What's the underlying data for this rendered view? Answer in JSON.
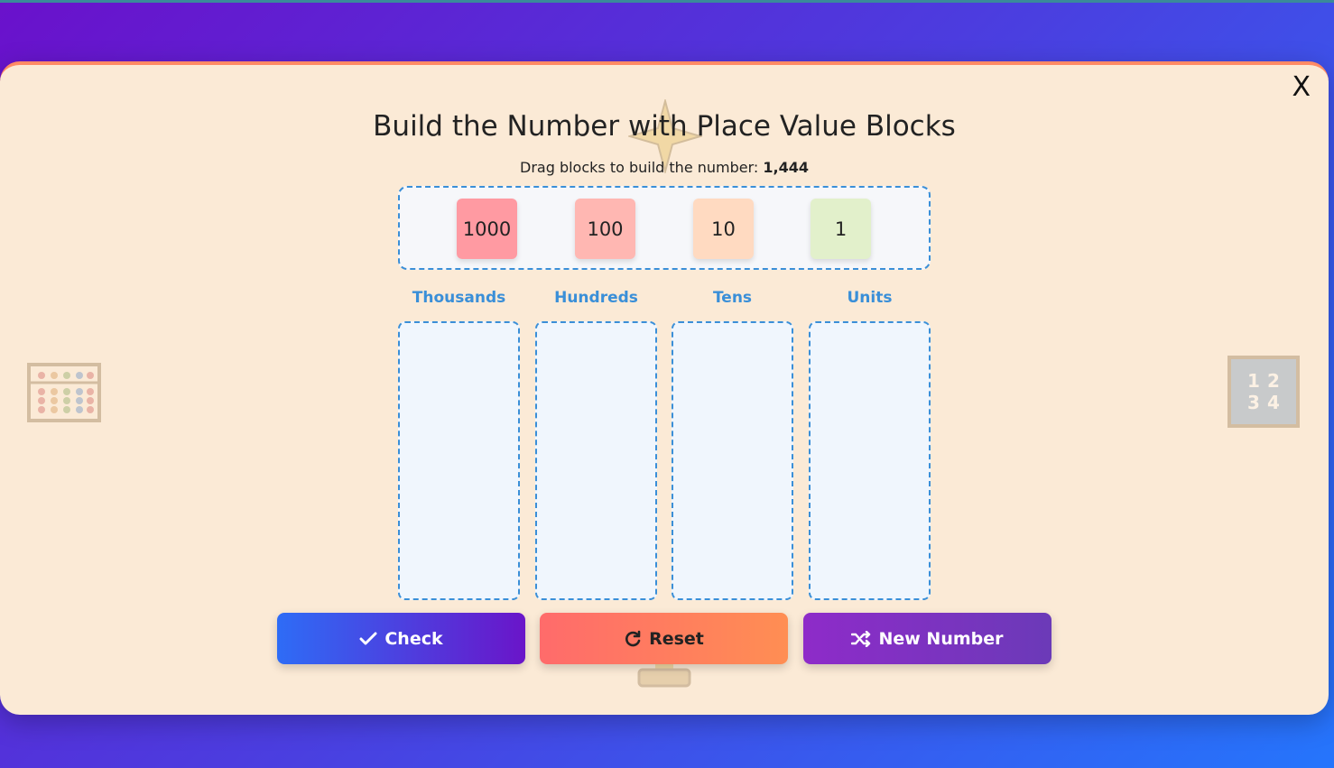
{
  "modal": {
    "close_label": "X",
    "title": "Build the Number with Place Value Blocks",
    "instruction_prefix": "Drag blocks to build the number:",
    "target_number": "1,444"
  },
  "blocks": [
    {
      "label": "1000",
      "color": "#ff9aa2"
    },
    {
      "label": "100",
      "color": "#ffb7b2"
    },
    {
      "label": "10",
      "color": "#ffdac1"
    },
    {
      "label": "1",
      "color": "#e2f0cb"
    }
  ],
  "columns": [
    {
      "label": "Thousands"
    },
    {
      "label": "Hundreds"
    },
    {
      "label": "Tens"
    },
    {
      "label": "Units"
    }
  ],
  "buttons": {
    "check": "Check",
    "reset": "Reset",
    "new_number": "New Number"
  },
  "decor": {
    "number_grid": [
      "1",
      "2",
      "3",
      "4"
    ]
  },
  "colors": {
    "accent_blue": "#3a8fd8",
    "modal_bg": "#fbead6"
  }
}
